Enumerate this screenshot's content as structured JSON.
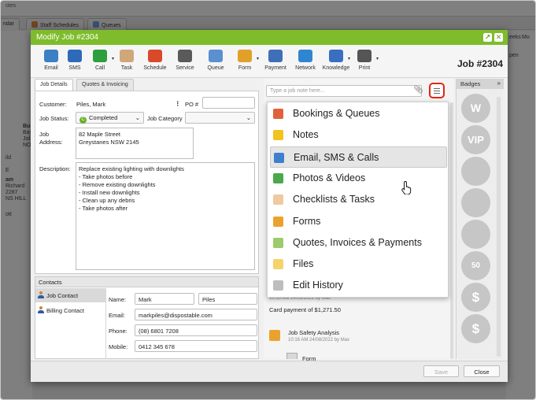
{
  "background": {
    "top_text": "otes",
    "tabs": [
      "ndar",
      "Staff Schedules",
      "Queues"
    ],
    "left_texts": [
      "Bus",
      "Bay",
      "Job",
      "NO",
      "ild",
      "E",
      "am",
      "Richard",
      "2287",
      "NS HILL",
      "ott"
    ],
    "right_texts": [
      "eeks",
      "Mo",
      "pen"
    ]
  },
  "modal": {
    "title": "Modify Job #2304",
    "job_number": "Job #2304",
    "toolbar": [
      {
        "label": "Email",
        "icon": "email-icon",
        "color": "#3c7fc4"
      },
      {
        "label": "SMS",
        "icon": "sms-icon",
        "color": "#2f6ab8"
      },
      {
        "label": "Call",
        "icon": "phone-icon",
        "color": "#2e9e3e"
      },
      {
        "label": "Task",
        "icon": "task-icon",
        "color": "#d0a77a"
      },
      {
        "label": "Schedule",
        "icon": "calendar-icon",
        "color": "#d94a2b"
      },
      {
        "label": "Service",
        "icon": "tools-icon",
        "color": "#5a5a5a"
      },
      {
        "label": "Queue",
        "icon": "queue-icon",
        "color": "#5a8fd0"
      },
      {
        "label": "Form",
        "icon": "form-icon",
        "color": "#e0a02a"
      },
      {
        "label": "Payment",
        "icon": "payment-icon",
        "color": "#3f6fb8"
      },
      {
        "label": "Network",
        "icon": "network-icon",
        "color": "#2f85d0"
      },
      {
        "label": "Knowledge",
        "icon": "knowledge-icon",
        "color": "#3a6ec0"
      },
      {
        "label": "Print",
        "icon": "printer-icon",
        "color": "#555555"
      }
    ],
    "tabs": [
      "Job Details",
      "Quotes & Invoicing"
    ],
    "form": {
      "customer_label": "Customer:",
      "customer_value": "Piles, Mark",
      "po_label": "PO #",
      "po_value": "",
      "status_label": "Job Status:",
      "status_value": "Completed",
      "status_icon_letter": "C",
      "category_label": "Job Category",
      "category_value": "",
      "address_label_1": "Job",
      "address_label_2": "Address:",
      "address_value": "82 Maple Street\nGreystanes NSW 2145",
      "description_label": "Description:",
      "description_value": "Replace existing lighting with downlights\n- Take photos before\n- Remove existing downlights\n- Install new downlights\n- Clean up any debris\n- Take photos after"
    },
    "contacts": {
      "header": "Contacts",
      "tabs": [
        "Job Contact",
        "Billing Contact"
      ],
      "name_label": "Name:",
      "first_name": "Mark",
      "last_name": "Piles",
      "email_label": "Email:",
      "email": "markpiles@dispostable.com",
      "phone_label": "Phone:",
      "phone": "(08) 6801 7208",
      "mobile_label": "Mobile:",
      "mobile": "0412 345 678"
    },
    "notes": {
      "placeholder": "Type a job note here...",
      "history": [
        {
          "text": "10:16 AM 24/08/2022 by Max",
          "small": true
        },
        {
          "text": "Card payment of $1,271.50",
          "small": false
        },
        {
          "text": "Job Safety Analysis",
          "small": false
        },
        {
          "text": "10:16 AM 24/08/2022 by Max",
          "small": true
        },
        {
          "text": "Form",
          "small": false
        }
      ]
    },
    "filter_menu": [
      {
        "label": "Bookings & Queues",
        "icon": "calendar-icon",
        "color": "#e0623b"
      },
      {
        "label": "Notes",
        "icon": "notes-icon",
        "color": "#f2c31c"
      },
      {
        "label": "Email, SMS & Calls",
        "icon": "speech-bubbles-icon",
        "color": "#3e7fd0",
        "highlighted": true
      },
      {
        "label": "Photos & Videos",
        "icon": "photo-icon",
        "color": "#4ba84b"
      },
      {
        "label": "Checklists & Tasks",
        "icon": "checklist-icon",
        "color": "#f0c9a0"
      },
      {
        "label": "Forms",
        "icon": "form-icon",
        "color": "#e9a32d"
      },
      {
        "label": "Quotes, Invoices & Payments",
        "icon": "invoice-icon",
        "color": "#9ccb6b"
      },
      {
        "label": "Files",
        "icon": "folder-icon",
        "color": "#f4d36b"
      },
      {
        "label": "Edit History",
        "icon": "history-icon",
        "color": "#bdbdbd"
      }
    ],
    "badges": {
      "header": "Badges",
      "items": [
        "W",
        "VIP",
        "",
        "",
        "",
        "50",
        "$",
        "$"
      ]
    },
    "footer": {
      "save": "Save",
      "close": "Close"
    }
  }
}
